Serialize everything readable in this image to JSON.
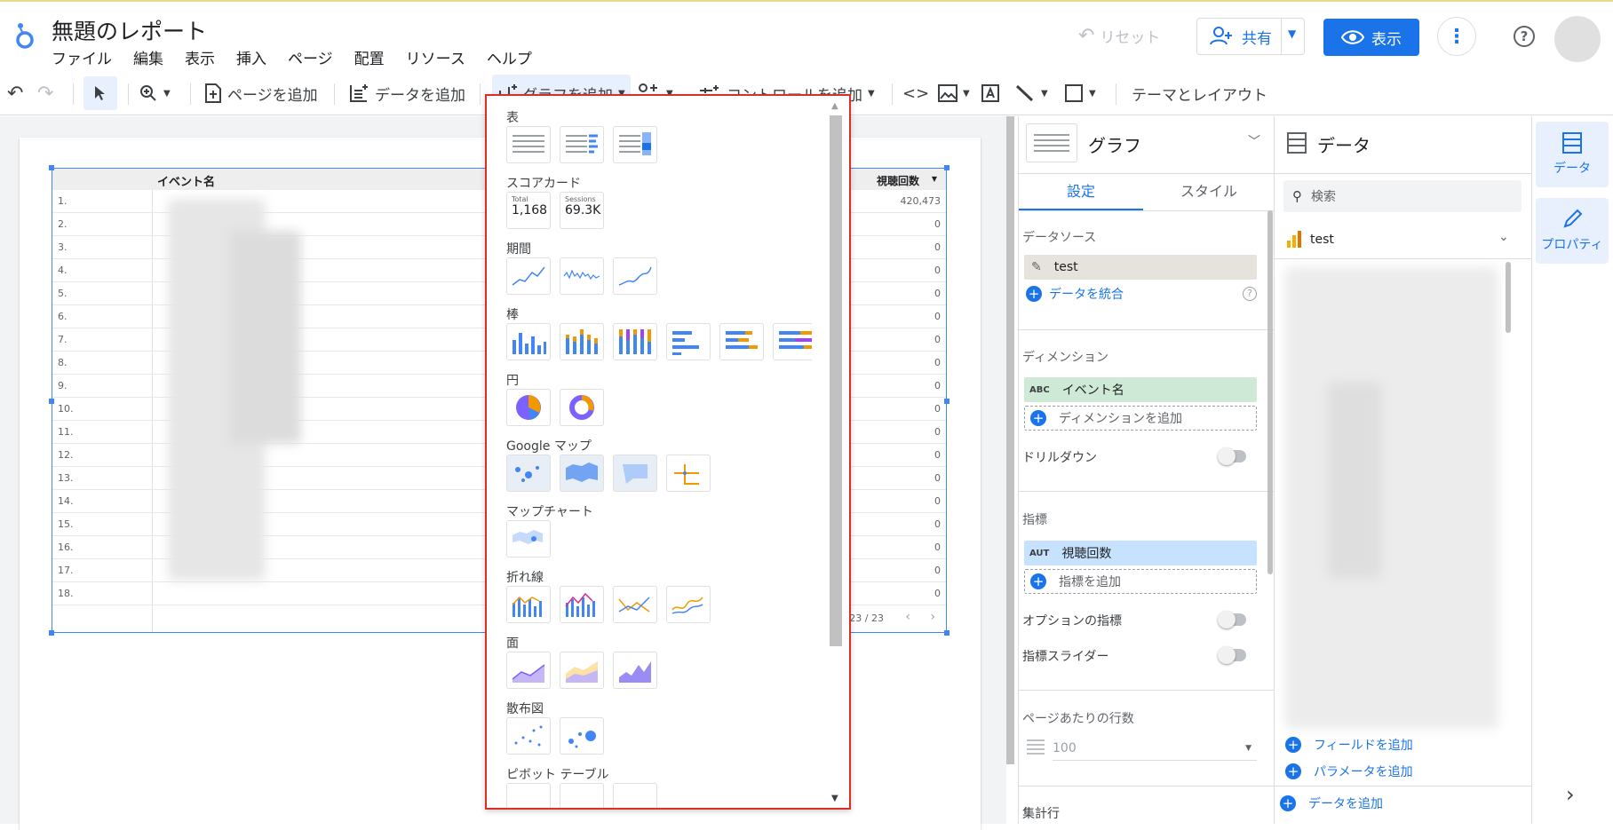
{
  "header": {
    "title": "無題のレポート",
    "menu": [
      "ファイル",
      "編集",
      "表示",
      "挿入",
      "ページ",
      "配置",
      "リソース",
      "ヘルプ"
    ],
    "reset_label": "リセット",
    "share_label": "共有",
    "view_label": "表示"
  },
  "toolbar": {
    "add_page": "ページを追加",
    "add_data": "データを追加",
    "add_chart": "グラフを追加",
    "add_control": "コントロールを追加",
    "theme_layout": "テーマとレイアウト"
  },
  "table": {
    "col_event": "イベント名",
    "col_views": "視聴回数",
    "rows": [
      {
        "n": "1.",
        "v": "420,473"
      },
      {
        "n": "2.",
        "v": "0"
      },
      {
        "n": "3.",
        "v": "0"
      },
      {
        "n": "4.",
        "v": "0"
      },
      {
        "n": "5.",
        "v": "0"
      },
      {
        "n": "6.",
        "v": "0"
      },
      {
        "n": "7.",
        "v": "0"
      },
      {
        "n": "8.",
        "v": "0"
      },
      {
        "n": "9.",
        "v": "0"
      },
      {
        "n": "10.",
        "v": "0"
      },
      {
        "n": "11.",
        "v": "0"
      },
      {
        "n": "12.",
        "v": "0"
      },
      {
        "n": "13.",
        "v": "0"
      },
      {
        "n": "14.",
        "v": "0"
      },
      {
        "n": "15.",
        "v": "0"
      },
      {
        "n": "16.",
        "v": "0"
      },
      {
        "n": "17.",
        "v": "0"
      },
      {
        "n": "18.",
        "v": "0"
      }
    ],
    "pagination": "1 - 23 / 23"
  },
  "chart_menu": {
    "sections": [
      "表",
      "スコアカード",
      "期間",
      "棒",
      "円",
      "Google マップ",
      "マップチャート",
      "折れ線",
      "面",
      "散布図",
      "ピボット テーブル"
    ],
    "scorecard1_label": "Total",
    "scorecard1_value": "1,168",
    "scorecard2_label": "Sessions",
    "scorecard2_value": "69.3K"
  },
  "graph_panel": {
    "title": "グラフ",
    "tab_settings": "設定",
    "tab_style": "スタイル",
    "datasource_label": "データソース",
    "datasource_value": "test",
    "blend_label": "データを統合",
    "dimension_label": "ディメンション",
    "dimension_type": "ABC",
    "dimension_value": "イベント名",
    "add_dimension": "ディメンションを追加",
    "drilldown_label": "ドリルダウン",
    "metric_label": "指標",
    "metric_type": "AUT",
    "metric_value": "視聴回数",
    "add_metric": "指標を追加",
    "optional_metrics": "オプションの指標",
    "metric_slider": "指標スライダー",
    "rows_per_page_label": "ページあたりの行数",
    "rows_per_page_value": "100",
    "summary_row": "集計行"
  },
  "data_panel": {
    "title": "データ",
    "search_placeholder": "検索",
    "source_name": "test",
    "add_field": "フィールドを追加",
    "add_parameter": "パラメータを追加",
    "add_data": "データを追加"
  },
  "rail": {
    "data_label": "データ",
    "properties_label": "プロパティ"
  },
  "colors": {
    "accent": "#1a73e8",
    "highlight_red": "#d93025",
    "dimension_chip": "#ceead6",
    "metric_chip": "#c6e2ff"
  }
}
